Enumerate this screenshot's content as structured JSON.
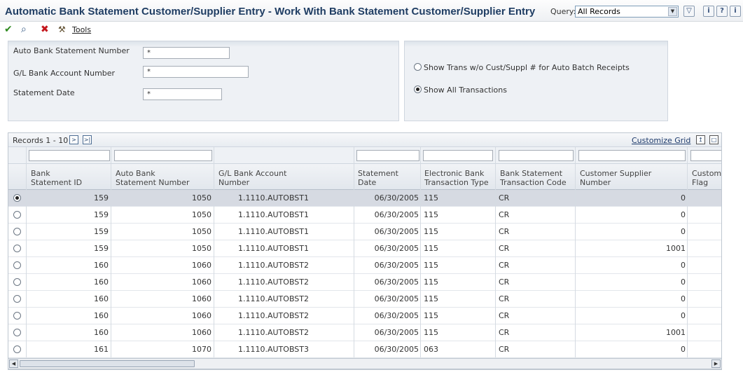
{
  "title": "Automatic Bank Statement Customer/Supplier Entry - Work With Bank Statement Customer/Supplier Entry",
  "query": {
    "label": "Query:",
    "value": "All Records"
  },
  "toolbar": {
    "tools_label": "Tools"
  },
  "header_fields": [
    {
      "label": "Auto Bank Statement Number",
      "value": "*"
    },
    {
      "label": "G/L Bank Account Number",
      "value": "*"
    },
    {
      "label": "Statement Date",
      "value": "*"
    }
  ],
  "options": [
    {
      "label": "Show Trans w/o Cust/Suppl # for Auto Batch Receipts",
      "selected": false
    },
    {
      "label": "Show All Transactions",
      "selected": true
    }
  ],
  "grid": {
    "records_label": "Records 1 - 10",
    "customize_label": "Customize Grid",
    "columns": [
      {
        "line1": "Bank",
        "line2": "Statement ID"
      },
      {
        "line1": "Auto Bank",
        "line2": "Statement Number"
      },
      {
        "line1": "G/L Bank Account",
        "line2": "Number"
      },
      {
        "line1": "Statement",
        "line2": "Date"
      },
      {
        "line1": "Electronic Bank",
        "line2": "Transaction Type"
      },
      {
        "line1": "Bank Statement",
        "line2": "Transaction Code"
      },
      {
        "line1": "Customer Supplier",
        "line2": "Number"
      },
      {
        "line1": "Customer",
        "line2": "Flag"
      }
    ],
    "rows": [
      [
        "159",
        "1050",
        "1.1110.AUTOBST1",
        "06/30/2005",
        "115",
        "CR",
        "0"
      ],
      [
        "159",
        "1050",
        "1.1110.AUTOBST1",
        "06/30/2005",
        "115",
        "CR",
        "0"
      ],
      [
        "159",
        "1050",
        "1.1110.AUTOBST1",
        "06/30/2005",
        "115",
        "CR",
        "0"
      ],
      [
        "159",
        "1050",
        "1.1110.AUTOBST1",
        "06/30/2005",
        "115",
        "CR",
        "1001"
      ],
      [
        "160",
        "1060",
        "1.1110.AUTOBST2",
        "06/30/2005",
        "115",
        "CR",
        "0"
      ],
      [
        "160",
        "1060",
        "1.1110.AUTOBST2",
        "06/30/2005",
        "115",
        "CR",
        "0"
      ],
      [
        "160",
        "1060",
        "1.1110.AUTOBST2",
        "06/30/2005",
        "115",
        "CR",
        "0"
      ],
      [
        "160",
        "1060",
        "1.1110.AUTOBST2",
        "06/30/2005",
        "115",
        "CR",
        "0"
      ],
      [
        "160",
        "1060",
        "1.1110.AUTOBST2",
        "06/30/2005",
        "115",
        "CR",
        "1001"
      ],
      [
        "161",
        "1070",
        "1.1110.AUTOBST3",
        "06/30/2005",
        "063",
        "CR",
        "0"
      ]
    ]
  }
}
